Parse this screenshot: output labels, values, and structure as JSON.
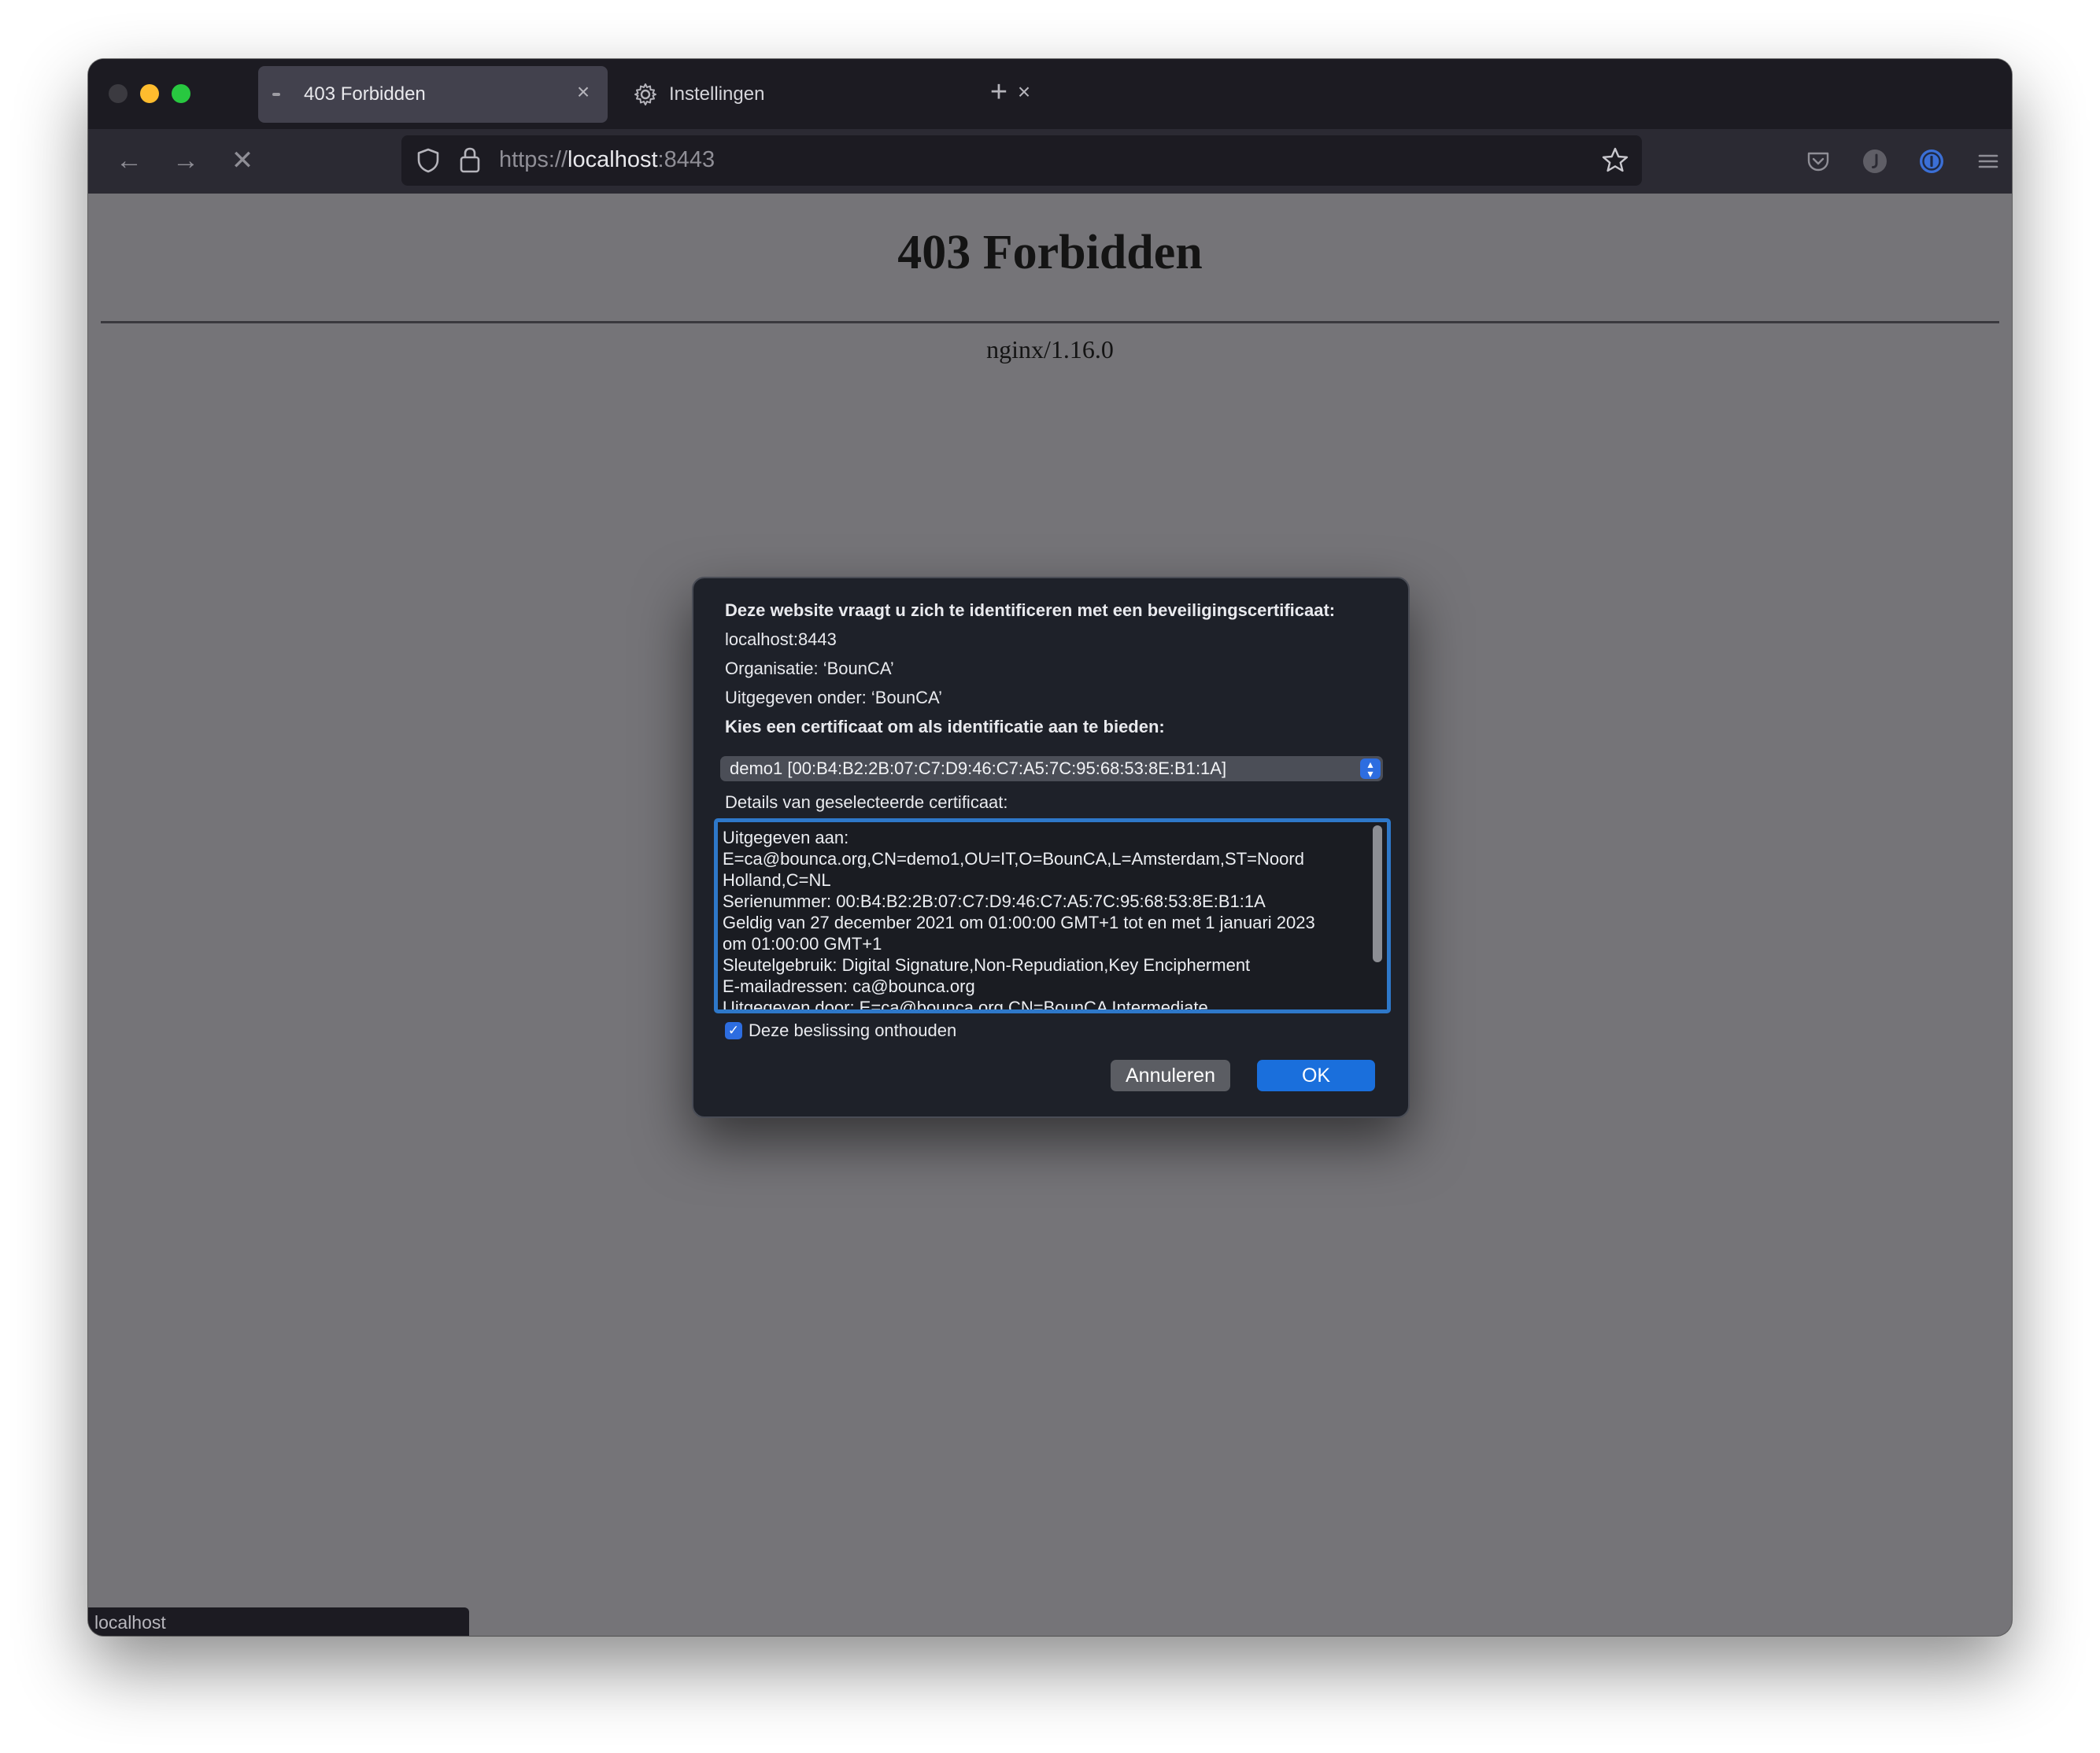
{
  "tabs": [
    {
      "title": "403 Forbidden",
      "active": true
    },
    {
      "title": "Instellingen",
      "active": false
    }
  ],
  "urlbar": {
    "scheme": "https://",
    "host": "localhost",
    "port": ":8443"
  },
  "page": {
    "title": "403 Forbidden",
    "server": "nginx/1.16.0"
  },
  "statusbar": {
    "text": "localhost"
  },
  "dialog": {
    "heading": "Deze website vraagt u zich te identificeren met een beveiligingscertificaat:",
    "host": "localhost:8443",
    "organization": "Organisatie: ‘BounCA’",
    "issued_under": "Uitgegeven onder: ‘BounCA’",
    "choose_label": "Kies een certificaat om als identificatie aan te bieden:",
    "selected_certificate": "demo1 [00:B4:B2:2B:07:C7:D9:46:C7:A5:7C:95:68:53:8E:B1:1A]",
    "details_label": "Details van geselecteerde certificaat:",
    "details_text": "Uitgegeven aan:\nE=ca@bounca.org,CN=demo1,OU=IT,O=BounCA,L=Amsterdam,ST=Noord\nHolland,C=NL\nSerienummer: 00:B4:B2:2B:07:C7:D9:46:C7:A5:7C:95:68:53:8E:B1:1A\nGeldig van 27 december 2021 om 01:00:00 GMT+1 tot en met 1 januari 2023\nom 01:00:00 GMT+1\nSleutelgebruik: Digital Signature,Non-Repudiation,Key Encipherment\nE-mailadressen: ca@bounca.org\nUitgegeven door: E=ca@bounca.org,CN=BounCA Intermediate",
    "remember_label": "Deze beslissing onthouden",
    "remember_checked": true,
    "cancel_label": "Annuleren",
    "ok_label": "OK"
  },
  "colors": {
    "accent": "#1a6fdc",
    "page_background": "#757478",
    "dialog_background": "#1e2129"
  }
}
